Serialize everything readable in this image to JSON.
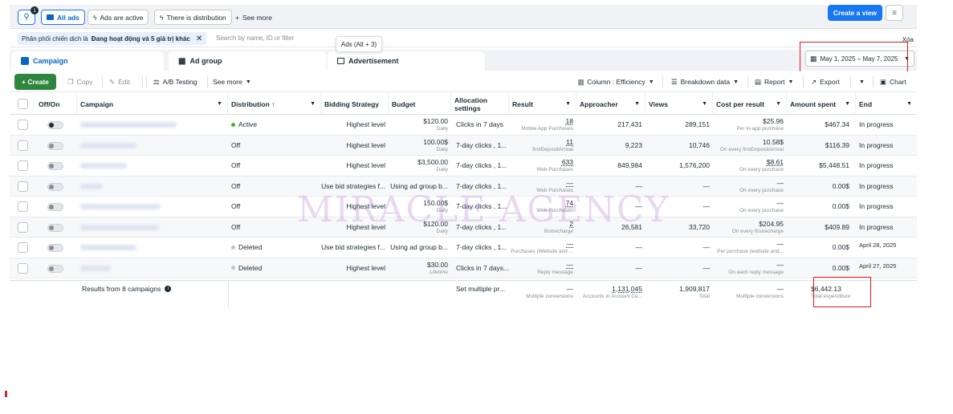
{
  "topbar": {
    "all_ads": "All ads",
    "ads_active": "Ads are active",
    "there_is_distribution": "There is distribution",
    "see_more": "See more",
    "create_view": "Create a view",
    "badge_count": "1"
  },
  "filter": {
    "pill_prefix": "Phân phối chiến dịch là ",
    "pill_bold": "Đang hoạt động và 5 giá trị khác",
    "search_placeholder": "Search by name, ID or filter",
    "clear": "Xóa",
    "tooltip": "Ads (Alt + 3)"
  },
  "tabs": {
    "campaign": "Campaign",
    "ad_group": "Ad group",
    "advertisement": "Advertisement",
    "date_range": "May 1, 2025 – May 7, 2025"
  },
  "toolbar": {
    "create": "+ Create",
    "copy": "Copy",
    "edit": "Edit",
    "ab_testing": "A/B Testing",
    "see_more": "See more",
    "columns": "Column : Efficiency",
    "breakdown": "Breakdown data",
    "report": "Report",
    "export": "Export",
    "chart": "Chart"
  },
  "columns": {
    "off_on": "Off/On",
    "campaign": "Campaign",
    "distribution": "Distribution ↑",
    "bidding": "Bidding Strategy",
    "budget": "Budget",
    "allocation_1": "Allocation",
    "allocation_2": "settings",
    "result": "Result",
    "approacher": "Approacher",
    "views": "Views",
    "cost_per_result": "Cost per result",
    "amount_spent": "Amount spent",
    "end": "End"
  },
  "rows": [
    {
      "distribution": "Active",
      "status": "active",
      "bidding": "Highest level",
      "budget": "$120.00",
      "budget_sub": "Daily",
      "allocation": "Clicks in 7 days",
      "result": "18",
      "result_sub": "Mobile App Purchases",
      "approacher": "217,431",
      "views": "289,151",
      "cost": "$25.96",
      "cost_sub": "Per in-app purchase",
      "spent": "$467.34",
      "end": "In progress"
    },
    {
      "distribution": "Off",
      "status": "off",
      "bidding": "Highest level",
      "budget": "100.00$",
      "budget_sub": "Daily",
      "allocation": "7-day clicks , 1...",
      "result": "11",
      "result_sub": "firstDepositArrival",
      "approacher": "9,223",
      "views": "10,746",
      "cost": "10.58$",
      "cost_sub": "On every firstDepositArrival",
      "spent": "$116.39",
      "end": "In progress"
    },
    {
      "distribution": "Off",
      "status": "off",
      "bidding": "Highest level",
      "budget": "$3,500.00",
      "budget_sub": "Daily",
      "allocation": "7-day clicks , 1...",
      "result": "633",
      "result_sub": "Web Purchases",
      "approacher": "849,984",
      "views": "1,576,200",
      "cost": "$8.61",
      "cost_sub": "On every purchase",
      "spent": "$5,448.51",
      "end": "In progress"
    },
    {
      "distribution": "Off",
      "status": "off",
      "bidding": "Use bid strategies f...",
      "budget": "Using ad group b...",
      "budget_sub": "",
      "allocation": "7-day clicks , 1...",
      "result": "—",
      "result_sub": "Web Purchases",
      "approacher": "—",
      "views": "—",
      "cost": "—",
      "cost_sub": "On every purchase",
      "spent": "0.00$",
      "end": "In progress"
    },
    {
      "distribution": "Off",
      "status": "off",
      "bidding": "Highest level",
      "budget": "150.00$",
      "budget_sub": "Daily",
      "allocation": "7-day clicks , 1...",
      "result": "74",
      "result_sub": "Web Purchases",
      "approacher": "—",
      "views": "—",
      "cost": "—",
      "cost_sub": "On every purchase",
      "spent": "0.00$",
      "end": "In progress"
    },
    {
      "distribution": "Off",
      "status": "off",
      "bidding": "Highest level",
      "budget": "$120.00",
      "budget_sub": "Daily",
      "allocation": "7-day clicks , 1...",
      "result": "2",
      "result_sub": "firstrecharge",
      "approacher": "26,581",
      "views": "33,720",
      "cost": "$204.95",
      "cost_sub": "On every firstrecharge",
      "spent": "$409.89",
      "end": "In progress"
    },
    {
      "distribution": "Deleted",
      "status": "deleted",
      "bidding": "Use bid strategies f...",
      "budget": "Using ad group b...",
      "budget_sub": "",
      "allocation": "7-day clicks , 1...",
      "result": "—",
      "result_sub": "Purchases (Website and ...",
      "approacher": "—",
      "views": "—",
      "cost": "—",
      "cost_sub": "Per purchase (website and...",
      "spent": "0.00$",
      "end": "April 28, 2025"
    },
    {
      "distribution": "Deleted",
      "status": "deleted",
      "bidding": "Highest level",
      "budget": "$30.00",
      "budget_sub": "Lifetime",
      "allocation": "Clicks in 7 days...",
      "result": "—",
      "result_sub": "Reply message",
      "approacher": "—",
      "views": "—",
      "cost": "—",
      "cost_sub": "On each reply message",
      "spent": "0.00$",
      "end": "April 27, 2025"
    }
  ],
  "summary": {
    "label": "Results from 8 campaigns",
    "allocation": "Set multiple pr...",
    "result": "—",
    "result_sub": "Multiple conversions",
    "approacher": "1,131,045",
    "approacher_sub": "Accounts in Account Ce...",
    "views": "1,909,817",
    "views_sub": "Total",
    "cost": "—",
    "cost_sub": "Multiple conversions",
    "spent": "$6,442.13",
    "spent_sub": "Total expenditure"
  },
  "watermark": "MIRACLE AGENCY",
  "colors": {
    "brand_blue": "#1877f2",
    "create_green": "#2e8540",
    "active_green": "#42b72a",
    "highlight_red": "#e0191e"
  }
}
